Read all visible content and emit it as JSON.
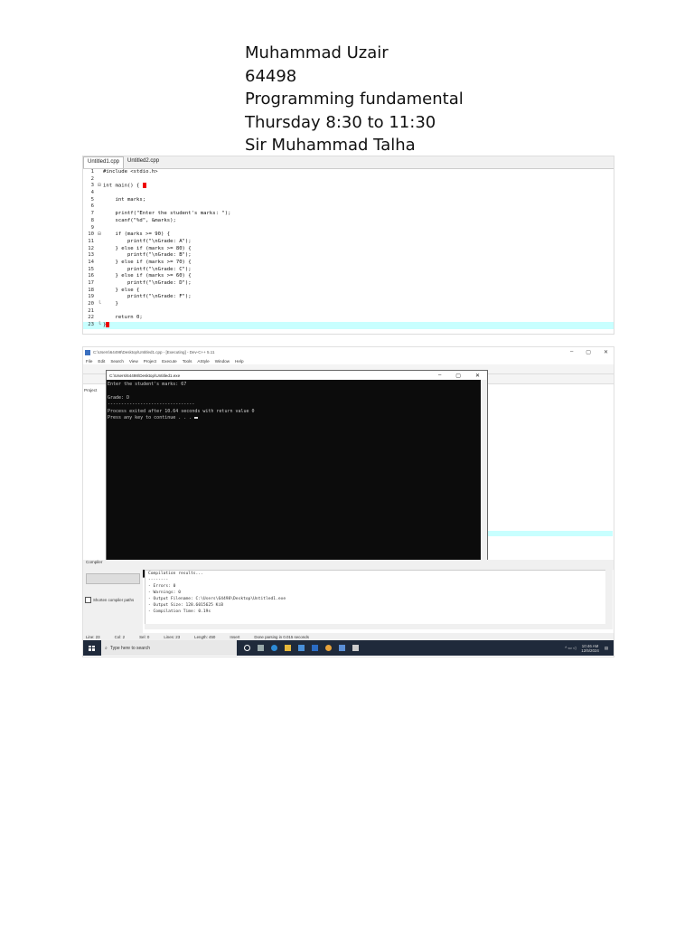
{
  "header": {
    "name": "Muhammad Uzair",
    "id": "64498",
    "course": "Programming fundamental",
    "schedule": "Thursday 8:30 to 11:30",
    "instructor": "Sir Muhammad Talha"
  },
  "editor": {
    "tabs": [
      "Untitled1.cpp",
      "Untitled2.cpp"
    ],
    "lines": [
      {
        "n": "1",
        "fold": "",
        "code": "#include <stdio.h>"
      },
      {
        "n": "2",
        "fold": "",
        "code": ""
      },
      {
        "n": "3",
        "fold": "⊟",
        "code": "int main() {"
      },
      {
        "n": "4",
        "fold": "",
        "code": ""
      },
      {
        "n": "5",
        "fold": "",
        "code": "    int marks;"
      },
      {
        "n": "6",
        "fold": "",
        "code": ""
      },
      {
        "n": "7",
        "fold": "",
        "code": "    printf(\"Enter the student's marks: \");"
      },
      {
        "n": "8",
        "fold": "",
        "code": "    scanf(\"%d\", &marks);"
      },
      {
        "n": "9",
        "fold": "",
        "code": ""
      },
      {
        "n": "10",
        "fold": "⊟",
        "code": "    if (marks >= 90) {"
      },
      {
        "n": "11",
        "fold": "",
        "code": "        printf(\"\\nGrade: A\");"
      },
      {
        "n": "12",
        "fold": "",
        "code": "    } else if (marks >= 80) {"
      },
      {
        "n": "13",
        "fold": "",
        "code": "        printf(\"\\nGrade: B\");"
      },
      {
        "n": "14",
        "fold": "",
        "code": "    } else if (marks >= 70) {"
      },
      {
        "n": "15",
        "fold": "",
        "code": "        printf(\"\\nGrade: C\");"
      },
      {
        "n": "16",
        "fold": "",
        "code": "    } else if (marks >= 60) {"
      },
      {
        "n": "17",
        "fold": "",
        "code": "        printf(\"\\nGrade: D\");"
      },
      {
        "n": "18",
        "fold": "",
        "code": "    } else {"
      },
      {
        "n": "19",
        "fold": "",
        "code": "        printf(\"\\nGrade: F\");"
      },
      {
        "n": "20",
        "fold": "└",
        "code": "    }"
      },
      {
        "n": "21",
        "fold": "",
        "code": ""
      },
      {
        "n": "22",
        "fold": "",
        "code": "    return 0;"
      },
      {
        "n": "23",
        "fold": "└",
        "code": "}"
      }
    ]
  },
  "ide": {
    "title": "C:\\Users\\64498\\Desktop\\Untitled1.cpp - [Executing] - Dev-C++ 5.11",
    "menu": [
      "File",
      "Edit",
      "Search",
      "View",
      "Project",
      "Execute",
      "Tools",
      "AStyle",
      "Window",
      "Help"
    ],
    "project_tab": "Project",
    "window_buttons": [
      "–",
      "▢",
      "✕"
    ],
    "console": {
      "title": "C:\\Users\\64498\\Desktop\\Untitled1.exe",
      "lines": [
        "Enter the student's marks: 67",
        "",
        "Grade: D",
        "--------------------------------",
        "Process exited after 10.64 seconds with return value 0",
        "Press any key to continue . . . "
      ]
    },
    "compiler_tab": "Compiler",
    "shorten_paths_label": "Shorten compiler paths",
    "compile_log": [
      "Compilation results...",
      "--------",
      "- Errors: 0",
      "- Warnings: 0",
      "- Output Filename: C:\\Users\\64498\\Desktop\\Untitled1.exe",
      "- Output Size: 128.6015625 KiB",
      "- Compilation Time: 0.19s"
    ],
    "status": {
      "line": "Line: 23",
      "col": "Col: 2",
      "sel": "Sel: 0",
      "lines": "Lines: 23",
      "length": "Length: 450",
      "mode": "Insert",
      "message": "Done parsing in 0.015 seconds"
    },
    "taskbar": {
      "search_placeholder": "Type here to search",
      "time": "10:46 AM",
      "date": "12/5/2024"
    }
  }
}
